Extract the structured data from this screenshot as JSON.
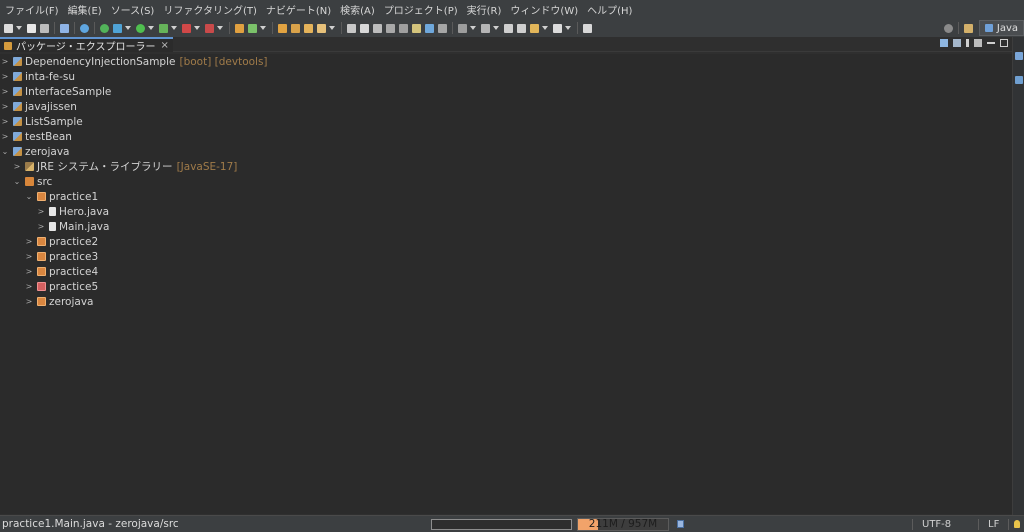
{
  "menu": [
    "ファイル(F)",
    "編集(E)",
    "ソース(S)",
    "リファクタリング(T)",
    "ナビゲート(N)",
    "検索(A)",
    "プロジェクト(P)",
    "実行(R)",
    "ウィンドウ(W)",
    "ヘルプ(H)"
  ],
  "perspective": {
    "label": "Java"
  },
  "view": {
    "title": "パッケージ・エクスプローラー",
    "close": "×"
  },
  "tree": [
    {
      "label": "DependencyInjectionSample",
      "decoration": "[boot] [devtools]",
      "icon": "project-icon",
      "expanded": false
    },
    {
      "label": "inta-fe-su",
      "decoration": "",
      "icon": "project-icon",
      "expanded": false
    },
    {
      "label": "InterfaceSample",
      "decoration": "",
      "icon": "project-icon",
      "expanded": false
    },
    {
      "label": "javajissen",
      "decoration": "",
      "icon": "project-icon",
      "expanded": false
    },
    {
      "label": "ListSample",
      "decoration": "",
      "icon": "project-icon",
      "expanded": false
    },
    {
      "label": "testBean",
      "decoration": "",
      "icon": "project-icon",
      "expanded": false
    },
    {
      "label": "zerojava",
      "decoration": "",
      "icon": "project-icon",
      "expanded": true
    },
    {
      "label": "JRE システム・ライブラリー",
      "decoration": "[JavaSE-17]",
      "icon": "library-icon",
      "expanded": false
    },
    {
      "label": "src",
      "decoration": "",
      "icon": "source-folder-icon",
      "expanded": true
    },
    {
      "label": "practice1",
      "decoration": "",
      "icon": "package-icon",
      "expanded": true
    },
    {
      "label": "Hero.java",
      "decoration": "",
      "icon": "java-file-icon",
      "expanded": false
    },
    {
      "label": "Main.java",
      "decoration": "",
      "icon": "java-file-icon",
      "expanded": false
    },
    {
      "label": "practice2",
      "decoration": "",
      "icon": "package-icon",
      "expanded": false
    },
    {
      "label": "practice3",
      "decoration": "",
      "icon": "package-icon",
      "expanded": false
    },
    {
      "label": "practice4",
      "decoration": "",
      "icon": "package-icon",
      "expanded": false
    },
    {
      "label": "practice5",
      "decoration": "",
      "icon": "package-error-icon",
      "expanded": false
    },
    {
      "label": "zerojava",
      "decoration": "",
      "icon": "package-icon",
      "expanded": false
    }
  ],
  "status": {
    "path": "practice1.Main.java - zerojava/src",
    "heap": "211M / 957M",
    "heap_used_fraction": 0.22,
    "encoding": "UTF-8",
    "line_delimiter": "LF"
  }
}
